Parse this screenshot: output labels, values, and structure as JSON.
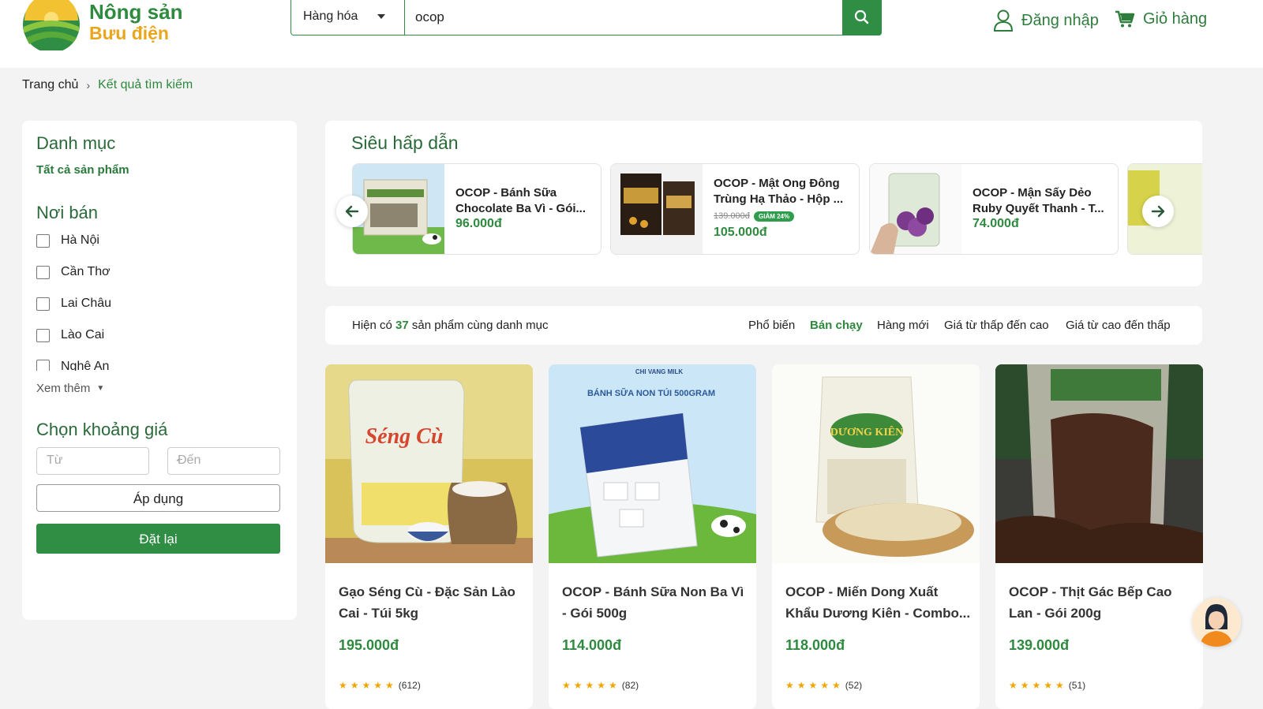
{
  "header": {
    "logo_line1": "Nông sản",
    "logo_line2": "Bưu điện",
    "search_category": "Hàng hóa",
    "search_value": "ocop",
    "login_label": "Đăng nhập",
    "cart_label": "Giỏ hàng"
  },
  "breadcrumb": {
    "home": "Trang chủ",
    "current": "Kết quả tìm kiếm"
  },
  "sidebar": {
    "category_title": "Danh mục",
    "all_products": "Tất cả sản phẩm",
    "seller_title": "Nơi bán",
    "locations": [
      "Hà Nội",
      "Cần Thơ",
      "Lai Châu",
      "Lào Cai",
      "Nghệ An"
    ],
    "see_more": "Xem thêm",
    "price_title": "Chọn khoảng giá",
    "price_from_placeholder": "Từ",
    "price_to_placeholder": "Đến",
    "apply_label": "Áp dụng",
    "reset_label": "Đặt lại"
  },
  "promo": {
    "title": "Siêu hấp dẫn",
    "items": [
      {
        "name": "OCOP - Bánh Sữa Chocolate Ba Vì - Gói...",
        "price": "96.000đ"
      },
      {
        "name": "OCOP - Mật Ong Đông Trùng Hạ Thảo - Hộp ...",
        "old_price": "139.000đ",
        "badge": "GIẢM 24%",
        "price": "105.000đ"
      },
      {
        "name": "OCOP - Mận Sấy Dẻo Ruby Quyết Thanh - T...",
        "price": "74.000đ"
      }
    ]
  },
  "results": {
    "count_prefix": "Hiện có",
    "count": "37",
    "count_suffix": "sản phẩm cùng danh mục",
    "sort_options": [
      "Phổ biến",
      "Bán chạy",
      "Hàng mới",
      "Giá từ thấp đến cao",
      "Giá từ cao đến thấp"
    ],
    "active_sort": "Bán chạy"
  },
  "products": [
    {
      "name": "Gạo Séng Cù - Đặc Sản Lào Cai - Túi 5kg",
      "price": "195.000đ",
      "stars": "★★★★★",
      "reviews": "(612)"
    },
    {
      "name": "OCOP - Bánh Sữa Non Ba Vì - Gói 500g",
      "price": "114.000đ",
      "stars": "★★★★★",
      "reviews": "(82)"
    },
    {
      "name": "OCOP - Miến Dong Xuất Khẩu Dương Kiên - Combo...",
      "price": "118.000đ",
      "stars": "★★★★★",
      "reviews": "(52)"
    },
    {
      "name": "OCOP - Thịt Gác Bếp Cao Lan - Gói 200g",
      "price": "139.000đ",
      "stars": "★★★★★",
      "reviews": "(51)"
    }
  ],
  "product_images": {
    "p1": {
      "brand": "Séng Cù"
    },
    "p2": {
      "brand": "CHI VANG MILK",
      "caption": "BÁNH SỮA NON TÚI 500GRAM"
    },
    "p3": {
      "brand": "DƯƠNG KIÊN"
    }
  },
  "colors": {
    "brand_green": "#2f8d44",
    "price_green": "#2e8a3e",
    "brand_yellow": "#e9a51c",
    "star": "#f0a500"
  },
  "icons": {
    "search": "search-icon",
    "user": "user-icon",
    "cart": "cart-icon",
    "chevron": "chevron-right-icon",
    "arrow_left": "arrow-left-icon",
    "arrow_right": "arrow-right-icon",
    "chat": "chat-assistant-icon"
  }
}
